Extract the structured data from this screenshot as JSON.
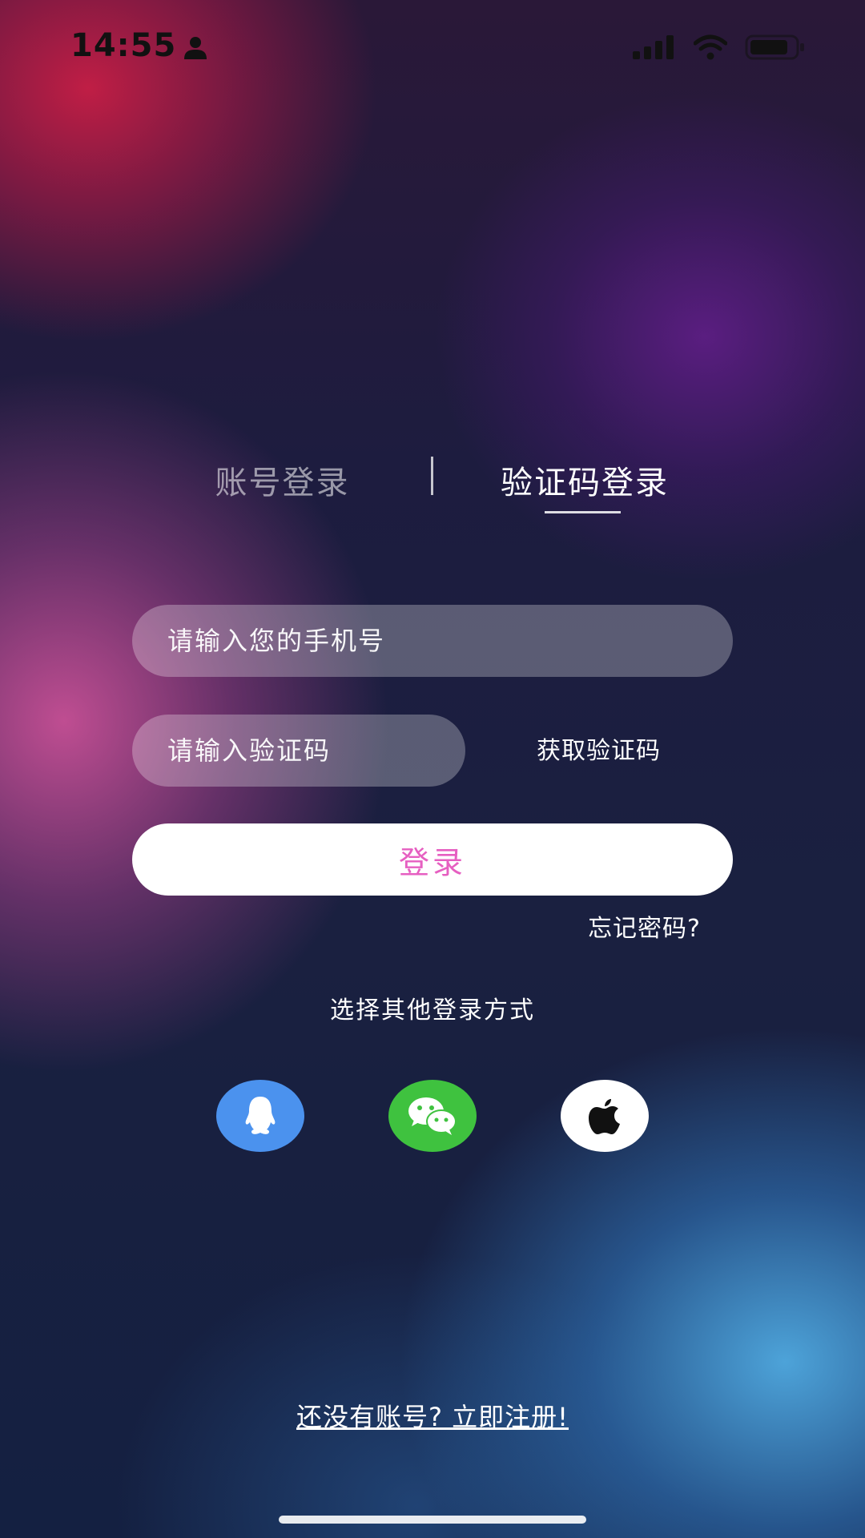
{
  "status_bar": {
    "time": "14:55",
    "icons": [
      "person-icon",
      "signal-icon",
      "wifi-icon",
      "battery-icon"
    ]
  },
  "tabs": [
    {
      "label": "账号登录",
      "active": false
    },
    {
      "label": "验证码登录",
      "active": true
    }
  ],
  "form": {
    "phone_placeholder": "请输入您的手机号",
    "phone_value": "",
    "code_placeholder": "请输入验证码",
    "code_value": "",
    "get_code_label": "获取验证码",
    "login_label": "登录",
    "forgot_label": "忘记密码?"
  },
  "other_login": {
    "title": "选择其他登录方式",
    "providers": [
      {
        "name": "qq",
        "icon": "qq-penguin-icon",
        "color": "#4b92ee"
      },
      {
        "name": "wechat",
        "icon": "wechat-icon",
        "color": "#3fc23f"
      },
      {
        "name": "apple",
        "icon": "apple-icon",
        "color": "#ffffff"
      }
    ]
  },
  "register_label": "还没有账号? 立即注册!",
  "colors": {
    "login_text": "#e65fc1",
    "input_bg": "rgba(255,255,255,0.28)"
  }
}
